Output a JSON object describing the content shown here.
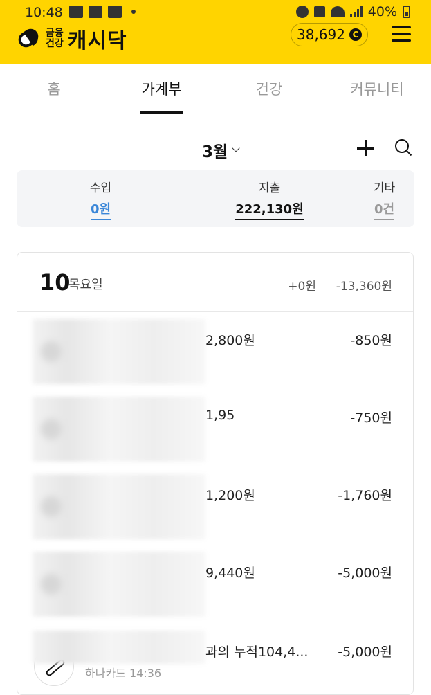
{
  "status": {
    "time": "10:48",
    "battery": "40%"
  },
  "header": {
    "brand_sub_line1": "금융",
    "brand_sub_line2": "건강",
    "brand_name": "캐시닥",
    "points": "38,692",
    "coin_symbol": "C",
    "accent_color": "#ffd400"
  },
  "tabs": [
    {
      "label": "홈",
      "active": false
    },
    {
      "label": "가계부",
      "active": true
    },
    {
      "label": "건강",
      "active": false
    },
    {
      "label": "커뮤니티",
      "active": false
    }
  ],
  "month": {
    "label": "3월"
  },
  "summary": {
    "income": {
      "title": "수입",
      "value": "0원",
      "color": "#3a86d8"
    },
    "expense": {
      "title": "지출",
      "value": "222,130원",
      "color": "#111111"
    },
    "etc": {
      "title": "기타",
      "value": "0건",
      "color": "#9a9a9a"
    }
  },
  "day": {
    "number": "10",
    "weekday": "목요일",
    "income": "+0원",
    "expense": "-13,360원"
  },
  "transactions": [
    {
      "desc": "2,800원",
      "amount": "-850원"
    },
    {
      "desc": "1,95",
      "amount": "-750원"
    },
    {
      "desc": "1,200원",
      "amount": "-1,760원"
    },
    {
      "desc": "9,440원",
      "amount": "-5,000원"
    },
    {
      "desc": "과의 누적104,4...",
      "amount": "-5,000원",
      "sub": "하나카드 14:36"
    }
  ]
}
